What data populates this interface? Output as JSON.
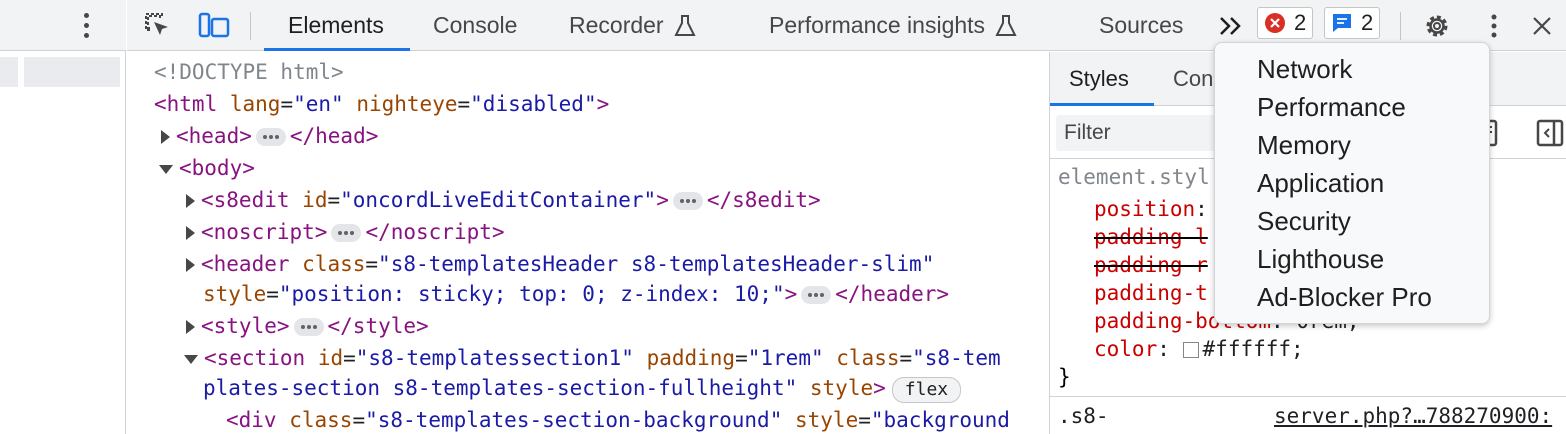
{
  "toolbar": {
    "tabs": [
      {
        "label": "Elements",
        "active": true
      },
      {
        "label": "Console"
      },
      {
        "label": "Recorder"
      },
      {
        "label": "Performance insights"
      },
      {
        "label": "Sources"
      }
    ],
    "more_tabs_icon": "double-chevron-icon",
    "errors_count": "2",
    "messages_count": "2",
    "icons": [
      "inspect-element-icon",
      "device-toggle-icon",
      "flask-icon",
      "error-icon",
      "message-icon",
      "gear-icon",
      "kebab-icon",
      "close-icon"
    ],
    "accent": "#1a73e8",
    "error_color": "#d93025"
  },
  "elements": {
    "lines": {
      "doctype": "<!DOCTYPE html>",
      "html_open": "<html",
      "html_attr1": "lang",
      "html_val1": "\"en\"",
      "html_attr2": "nighteye",
      "html_val2": "\"disabled\"",
      "html_close": ">",
      "head_open": "<head>",
      "head_close": "</head>",
      "body_open": "<body>",
      "s8edit_open": "<s8edit",
      "s8edit_attr": "id",
      "s8edit_val": "\"oncordLiveEditContainer\"",
      "s8edit_gt": ">",
      "s8edit_close": "</s8edit>",
      "noscript_open": "<noscript>",
      "noscript_close": "</noscript>",
      "header_open": "<header",
      "header_attr": "class",
      "header_val": "\"s8-templatesHeader s8-templatesHeader-slim\"",
      "header_attr2": "style",
      "header_val2": "\"position: sticky; top: 0; z-index: 10;\"",
      "header_gt": ">",
      "header_close": "</header>",
      "style_open": "<style>",
      "style_close": "</style>",
      "section_open": "<section",
      "section_attr1": "id",
      "section_val1": "\"s8-templatessection1\"",
      "section_attr2": "padding",
      "section_val2": "\"1rem\"",
      "section_attr3": "class",
      "section_val3a": "\"s8-tem",
      "section_val3b": "plates-section s8-templates-section-fullheight\"",
      "section_attr4": "style",
      "section_gt": ">",
      "flex_badge": "flex",
      "div_open": "<div",
      "div_attr1": "class",
      "div_val1": "\"s8-templates-section-background\"",
      "div_attr2": "style",
      "div_val2": "\"background"
    }
  },
  "styles": {
    "tabs": [
      {
        "label": "Styles",
        "active": true
      },
      {
        "label": "Con"
      }
    ],
    "filter_placeholder": "Filter",
    "element_style": "element.styl",
    "props": [
      {
        "name": "position",
        "colon": ":",
        "value": ""
      },
      {
        "name": "padding-l",
        "strike": true
      },
      {
        "name": "padding-r",
        "strike": true
      },
      {
        "name": "padding-t",
        "strike": false
      },
      {
        "name": "padding-bottom",
        "colon": ":",
        "value": "0rem;"
      },
      {
        "name": "color",
        "colon": ":",
        "value": "#ffffff;"
      }
    ],
    "close_brace": "}",
    "next_selector": ".s8-",
    "source_link": "server.php?…788270900:"
  },
  "more_tabs_menu": {
    "items": [
      "Network",
      "Performance",
      "Memory",
      "Application",
      "Security",
      "Lighthouse",
      "Ad-Blocker Pro"
    ]
  }
}
